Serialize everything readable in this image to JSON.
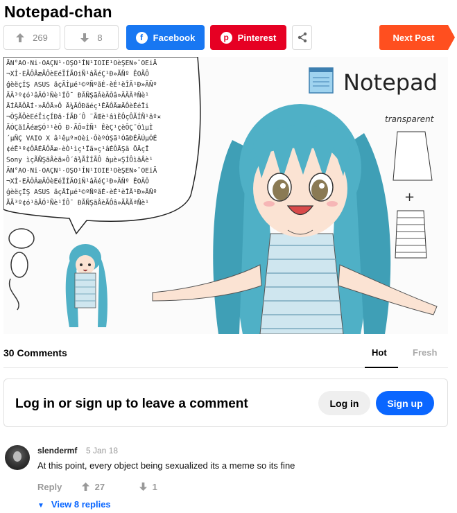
{
  "post": {
    "title": "Notepad-chan",
    "upvotes": "269",
    "downvotes": "8",
    "facebook_label": "Facebook",
    "pinterest_label": "Pinterest",
    "next_post_label": "Next Post"
  },
  "image": {
    "notepad_label": "Notepad",
    "transparent_label": "transparent",
    "plus_sign": "+",
    "speech_lines": [
      "ÃN°AO·Ni·OAÇN¹·OŞO¹ÍN¹IOIE¹OèŞEN»¨OEiÃ",
      "¬Xİ·EÃÔÂæÃÔèEéÏÍÃOiÑ¹âÃéÇ¹Ð»ÃÑº ÊOÃÔ",
      "ǵèëçÍŞ ASUS ãçÃİµé¹©ºÑºãÉ-èÉ¹èÎÃ¹Ð»ÃÑº",
      "ÃÃ³º¢ó¹âÃÓ¹Ñè¹ÍÔ¯ ÐÃÑŞãÂèÃÔâ»ÃÃÃªÑè¹",
      "ÃÍÂÃÔÃÍ·»ÃÔÃ»Ô Ã¾ÃÔÐãéç¹ÊÃÔÃæÃÔèÉéÎi",
      "¬ÒŞÃÔèEéÏiçÍÐâ·ÍÃÐ´Ô ¨ÃŒè¹âìÈÔçÔÃÍÑ¹âº¤",
      "ÃÓÇãîÃéæŞÓ¹¹èÔ Ð·ÃÔ¤ÍÑ¹ ÊèÇ¹çèÔÇ¨ÓìµÌ",
      "´µÑÇ VAIO X â¹êµº¤Oèi·ÔèºÓŞã¹ÓãÐÉÃÚµÓÉ",
      "¢éÊ¹º¢ÔÂÉÃÔÃæ·èÒ¹ìç¹Ïã»ç¹âÉÔÃŞã ÕÃçÎ",
      "Sony ìçÃÑŞãÂèã»Ô´â¾ÃÎÍÃÔ âµè¤ŞÍÔìãÂè¹",
      "ÃN°AO·Ni·OAÇN¹·OŞO¹ÍN¹IOIE¹OèŞEN»¨OEiÃ",
      "¬Xİ·EÃÔÂæÃÔèEéÏÍÃOiÑ¹âÃéÇ¹Ð»ÃÑº ÊOÃÔ",
      "ǵèëçÍŞ ASUS ãçÃİµé¹©ºÑºãÉ-èÉ¹èÎÃ¹Ð»ÃÑº",
      "ÃÃ³º¢ó¹âÃÓ¹Ñè¹ÍÔ¯ ÐÃÑŞãÂèÃÔâ»ÃÃÃªÑè¹"
    ]
  },
  "comments_section": {
    "count_label": "30 Comments",
    "tab_hot": "Hot",
    "tab_fresh": "Fresh",
    "login_prompt": "Log in or sign up to leave a comment",
    "login_button": "Log in",
    "signup_button": "Sign up"
  },
  "comment": {
    "username": "slendermf",
    "date": "5 Jan 18",
    "text": "At this point, every object being sexualized its a meme so its fine",
    "reply_label": "Reply",
    "upvotes": "27",
    "downvotes": "1",
    "view_replies": "View 8 replies"
  },
  "colors": {
    "facebook": "#1877f2",
    "pinterest": "#e60023",
    "next_post": "#ff4f1f",
    "signup": "#0a66ff",
    "hair": "#4fb0c6"
  }
}
